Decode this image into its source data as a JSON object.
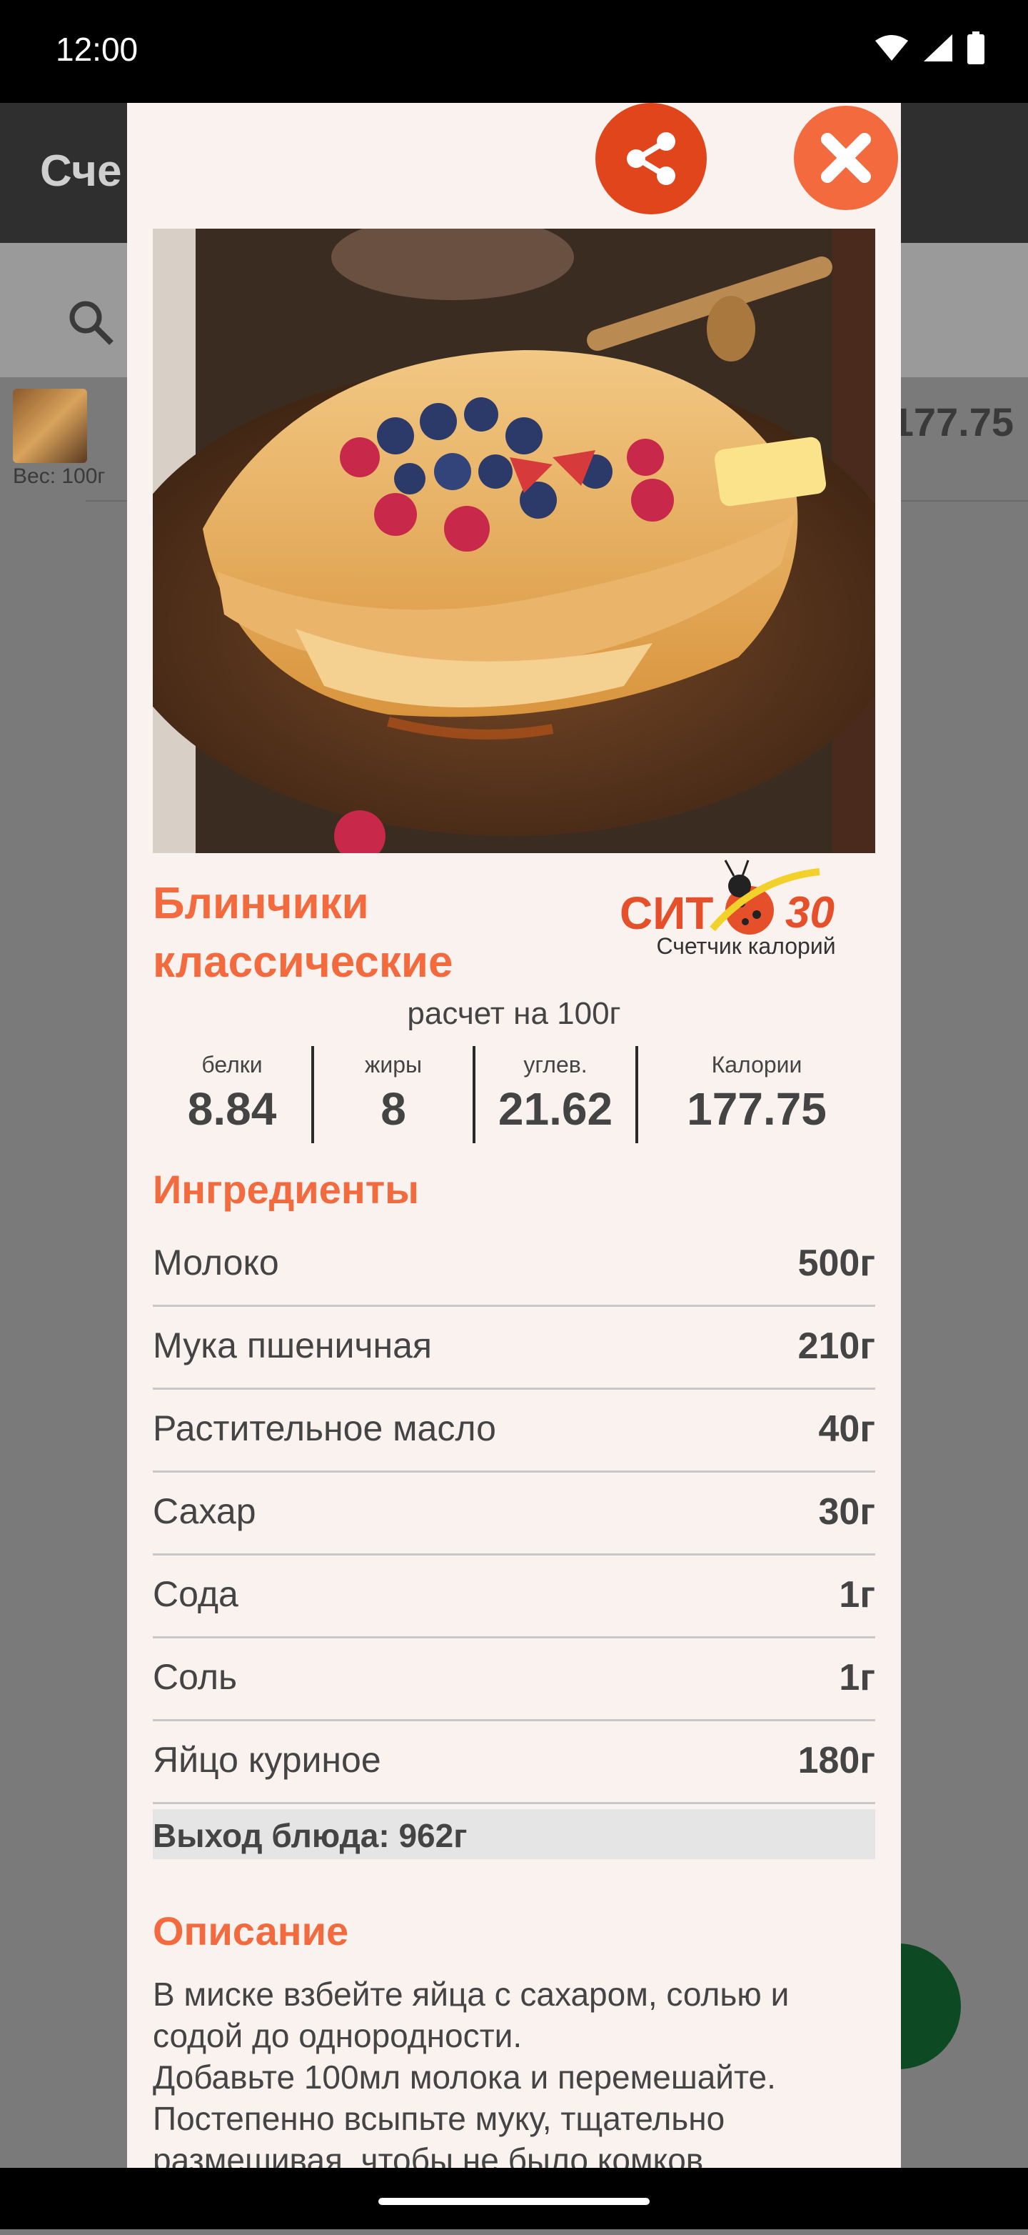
{
  "status_bar": {
    "time": "12:00"
  },
  "background_app": {
    "title_partial": "Сче",
    "row_weight": "Вес: 100г",
    "row_calories": "177.75"
  },
  "dialog": {
    "title": "Блинчики классические",
    "logo": {
      "brand_text": "СИТ",
      "brand_number": "30",
      "caption": "Счетчик калорий"
    },
    "per_label": "расчет на 100г",
    "macros": [
      {
        "label": "белки",
        "value": "8.84"
      },
      {
        "label": "жиры",
        "value": "8"
      },
      {
        "label": "углев.",
        "value": "21.62"
      },
      {
        "label": "Калории",
        "value": "177.75"
      }
    ],
    "ingredients_title": "Ингредиенты",
    "ingredients": [
      {
        "name": "Молоко",
        "amount": "500г"
      },
      {
        "name": "Мука пшеничная",
        "amount": "210г"
      },
      {
        "name": "Растительное масло",
        "amount": "40г"
      },
      {
        "name": "Сахар",
        "amount": "30г"
      },
      {
        "name": "Сода",
        "amount": "1г"
      },
      {
        "name": "Соль",
        "amount": "1г"
      },
      {
        "name": "Яйцо куриное",
        "amount": "180г"
      }
    ],
    "yield": "Выход блюда: 962г",
    "description_title": "Описание",
    "description": "В миске взбейте яйца с сахаром, солью и содой до однородности.\nДобавьте 100мл молока и перемешайте.\nПостепенно всыпьте муку, тщательно размешивая, чтобы не было комков."
  },
  "colors": {
    "accent": "#f26a3e",
    "share": "#e1451b",
    "dialog_bg": "#f9f2ee"
  }
}
